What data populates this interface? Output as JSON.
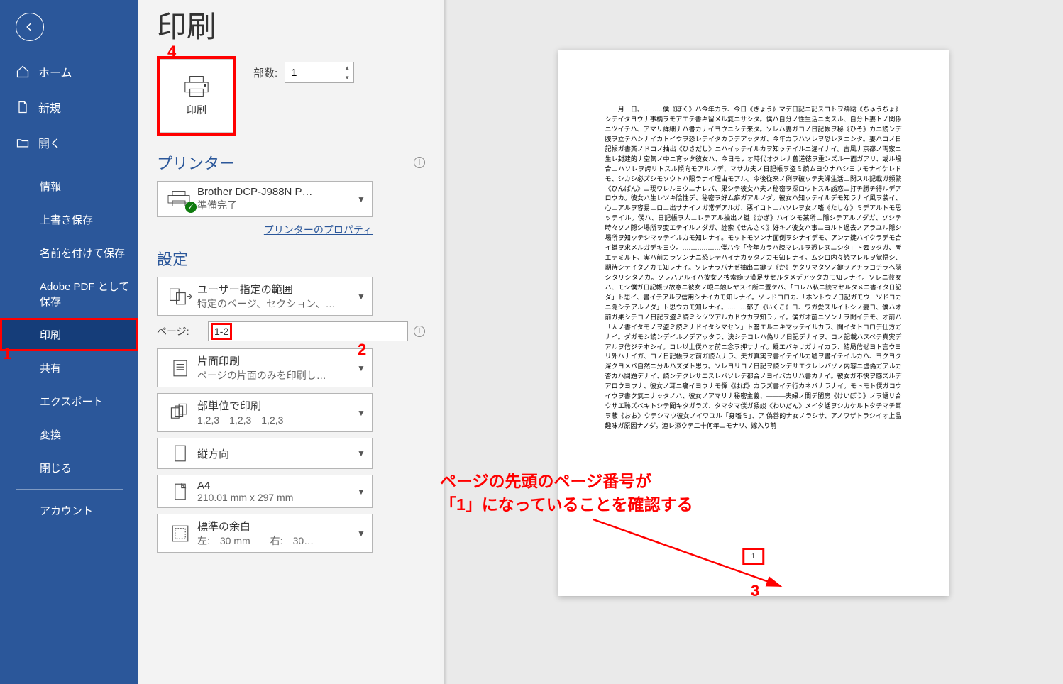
{
  "page_title": "印刷",
  "sidebar": {
    "items": [
      {
        "label": "ホーム"
      },
      {
        "label": "新規"
      },
      {
        "label": "開く"
      },
      {
        "label": "情報"
      },
      {
        "label": "上書き保存"
      },
      {
        "label": "名前を付けて保存"
      },
      {
        "label": "Adobe PDF として保存"
      },
      {
        "label": "印刷"
      },
      {
        "label": "共有"
      },
      {
        "label": "エクスポート"
      },
      {
        "label": "変換"
      },
      {
        "label": "閉じる"
      },
      {
        "label": "アカウント"
      }
    ]
  },
  "print_button_label": "印刷",
  "copies": {
    "label": "部数:",
    "value": "1"
  },
  "printer_section": {
    "title": "プリンター",
    "name": "Brother DCP-J988N P…",
    "status": "準備完了",
    "properties_link": "プリンターのプロパティ"
  },
  "settings_section": {
    "title": "設定",
    "range": {
      "main": "ユーザー指定の範囲",
      "sub": "特定のページ、セクション、…"
    },
    "pages_label": "ページ:",
    "pages_value": "1-2",
    "duplex": {
      "main": "片面印刷",
      "sub": "ページの片面のみを印刷し…"
    },
    "collate": {
      "main": "部単位で印刷",
      "sub": "1,2,3　1,2,3　1,2,3"
    },
    "orientation": {
      "main": "縦方向",
      "sub": ""
    },
    "paper": {
      "main": "A4",
      "sub": "210.01 mm x 297 mm"
    },
    "margins": {
      "main": "標準の余白",
      "sub": "左:　30 mm　　右:　30…"
    }
  },
  "annotations": {
    "n1": "1",
    "n2": "2",
    "n3": "3",
    "n4": "4",
    "note_l1": "ページの先頭のページ番号が",
    "note_l2": "「1」になっていることを確認する"
  },
  "preview": {
    "page_number": "1",
    "body": "　一月一日。………僕《ぼく》ハ今年カラ、今日《きょう》マデ日記ニ記スコトヲ躊躇《ちゅうちょ》シテイタヨウナ事柄ヲモアエテ書キ留メル氣ニサシタ。僕ハ自分ノ性生活ニ関スル、自分ト妻トノ関係ニツイテハ、アマリ詳細ナハ書カナイヨウニシテ来タ。ソレハ妻ガコノ日記帳ヲ秘《ひそ》カニ読ンデ腹ヲ立テハシナイカトイウヲ恐レテイタカラデアッタガ、今年カラハソレヲ恐レヌニシタ。妻ハコノ日記帳ガ書斎ノドコノ抽出《ひきだし》ニハイッテイルカヲ知ッテイルニ違イナイ。古風ナ京都ノ両家ニ生レ封建的ナ空気ノ中ニ育ッタ彼女ハ、今日モナオ時代オクレナ舊道徳ヲ重ンズル一面ガアリ、或ル場合ニハソレヲ誇リトスル傾向モアルノデ、マサカ夫ノ日記帳ヲ盗ミ読ムヨウナハシヨウモナイケレドモ、シカシ必ズシモソウトハ限ラナイ理由モアル。今後從来ノ例ヲ破ッテ夫婦生活ニ関スル記載ガ頻繁《ひんぱん》ニ現ワレルヨウニナレバ、果シテ彼女ハ夫ノ秘密ヲ探ロウトスル誘惑ニ打チ勝チ得ルデアロウカ。彼女ハ生レツキ陰性デ、秘密ヲ好ム癖ガアルノダ。彼女ハ知ッテイルデモ知ラナイ風ヲ装イ、心ニアルヲ容易ニロニ出サナイノガ常デアルガ、悪イコトニハソレヲ女ノ嗜《たしな》ミデアルトモ思ッテイル。僕ハ、日記帳ヲ人ニレテアル抽出ノ鍵《かぎ》ハイツモ某所ニ隠シテアルノダガ、ソシテ時々ソノ隠シ場所ヲ変エテイルノダガ、詮索《せんさく》好キノ彼女ハ事ニヨルト過去ノアラユル隠シ場所ヲ知ッテシマッテイルカモ知レナイ。モットモソンナ面倒ヲシナイデモ、アンナ鍵ハイクラデモ合イ鍵ヲ求メルガデキヨウ。………………僕ハ今「今年カラハ読マレルヲ恐レヌニシタ」ト云ッタガ、考エテミルト、実ハ前カラソンナニ恐レテハイナカッタノカモ知レナイ。ムシロ内々読マレルヲ覚悟シ、期待シテイタノカモ知レナイ。ソレナラバナゼ抽出ニ鍵ヲ《か》ケタリマタソノ鍵ヲアチラコチラヘ隠シタリシタノカ。ソレハアルイハ彼女ノ捜索癖ヲ満足サセルタメデアッタカモ知レナイ。ソレニ彼女ハ、モシ僕ガ日記帳ヲ故意ニ彼女ノ眼ニ触レヤスイ所ニ置ケバ、「コレハ私ニ読マセルタメニ書イタ日記ダ」ト思イ、書イテアルヲ信用シナイカモ知レナイ。ソレドコロカ、「ホントウノ日記ガモウーツドコカニ隠シテアルノダ」ト思ウカモ知レナイ。………郁子《いくこ》ヨ、ワガ愛スルイトシノ妻ヨ、僕ハオ前ガ果シテコノ日記ヲ盗ミ読ミシツツアルカドウカヲ知ラナイ。僕ガオ前ニソンナヲ聞イテモ、オ前ハ「人ノ書イタモノヲ盗ミ読ミナドイタシマセン」ト答エルニキマッテイルカラ、聞イタトコロデ仕方ガナイ。ダガモシ読ンデイルノデアッタラ、決シテコレハ偽リノ日記デナイヲ、コノ記載ハスベテ真実デアルヲ信ジテホシイ。コレ以上僕ハオ前ニ念ヲ押サナイ。疑エバキリガナイカラ、結局信ゼヨト言ウヨリ外ハナイガ、コノ日記帳ヲオ前ガ読ムナラ、夫ガ真実ヲ書イテイルカ嘘ヲ書イテイルカハ、ヨクヨク深クヨメバ自然ニ分ルハズダト思ウ。ソレヨリコノ日記ヲ読ンデサエクレレバソノ内容ニ虚偽ガアルカ否カハ問題デナイ、読ンデクレサエスレバソレデ都合ノヨイバカリハ書カナイ。彼女ガ不快ヲ感ズルデアロウヨウナ、彼女ノ耳ニ痛イヨウナモ憚《はば》カラズ書イテ行カネバナラナイ。モトモト僕ガコウイウヲ書ク氣ニナッタノハ、彼女ノアマリナ秘密主義、———夫婦ノ間デ閨房《けいぼう》ノヲ語リ合ウサエ恥ズベキトシテ聞キタガラズ、タマタマ僕ガ猥談《わいだん》メイタ話ヲシカケルトタチマチ耳ヲ蔽《おお》ウテシマウ彼女ノイワユル「身嗜ミ」、ア 偽善的ナ女ノラシサ、アノワザトラシイオ上品趣味ガ原因ナノダ。連レ添ウテ二十何年ニモナリ、嫁入り前"
  }
}
